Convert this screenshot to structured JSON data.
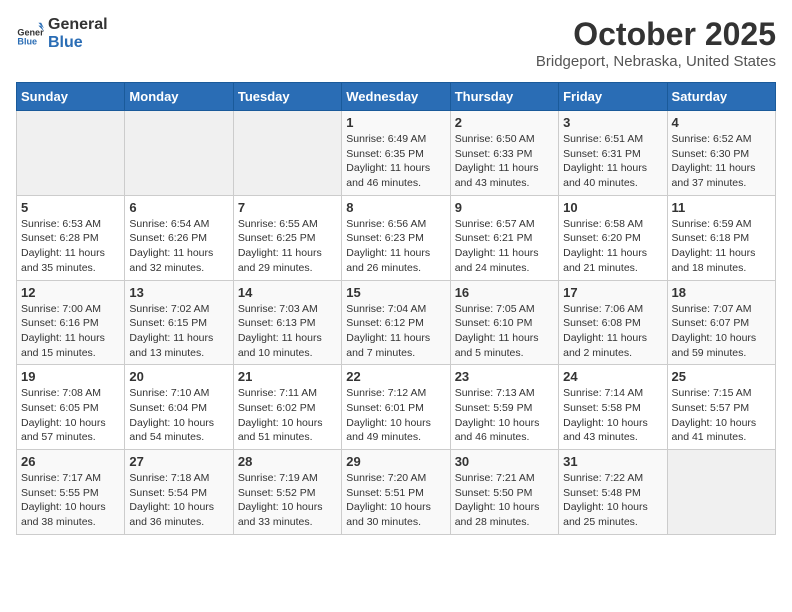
{
  "header": {
    "logo_general": "General",
    "logo_blue": "Blue",
    "month_title": "October 2025",
    "subtitle": "Bridgeport, Nebraska, United States"
  },
  "weekdays": [
    "Sunday",
    "Monday",
    "Tuesday",
    "Wednesday",
    "Thursday",
    "Friday",
    "Saturday"
  ],
  "weeks": [
    [
      {
        "day": "",
        "info": ""
      },
      {
        "day": "",
        "info": ""
      },
      {
        "day": "",
        "info": ""
      },
      {
        "day": "1",
        "info": "Sunrise: 6:49 AM\nSunset: 6:35 PM\nDaylight: 11 hours and 46 minutes."
      },
      {
        "day": "2",
        "info": "Sunrise: 6:50 AM\nSunset: 6:33 PM\nDaylight: 11 hours and 43 minutes."
      },
      {
        "day": "3",
        "info": "Sunrise: 6:51 AM\nSunset: 6:31 PM\nDaylight: 11 hours and 40 minutes."
      },
      {
        "day": "4",
        "info": "Sunrise: 6:52 AM\nSunset: 6:30 PM\nDaylight: 11 hours and 37 minutes."
      }
    ],
    [
      {
        "day": "5",
        "info": "Sunrise: 6:53 AM\nSunset: 6:28 PM\nDaylight: 11 hours and 35 minutes."
      },
      {
        "day": "6",
        "info": "Sunrise: 6:54 AM\nSunset: 6:26 PM\nDaylight: 11 hours and 32 minutes."
      },
      {
        "day": "7",
        "info": "Sunrise: 6:55 AM\nSunset: 6:25 PM\nDaylight: 11 hours and 29 minutes."
      },
      {
        "day": "8",
        "info": "Sunrise: 6:56 AM\nSunset: 6:23 PM\nDaylight: 11 hours and 26 minutes."
      },
      {
        "day": "9",
        "info": "Sunrise: 6:57 AM\nSunset: 6:21 PM\nDaylight: 11 hours and 24 minutes."
      },
      {
        "day": "10",
        "info": "Sunrise: 6:58 AM\nSunset: 6:20 PM\nDaylight: 11 hours and 21 minutes."
      },
      {
        "day": "11",
        "info": "Sunrise: 6:59 AM\nSunset: 6:18 PM\nDaylight: 11 hours and 18 minutes."
      }
    ],
    [
      {
        "day": "12",
        "info": "Sunrise: 7:00 AM\nSunset: 6:16 PM\nDaylight: 11 hours and 15 minutes."
      },
      {
        "day": "13",
        "info": "Sunrise: 7:02 AM\nSunset: 6:15 PM\nDaylight: 11 hours and 13 minutes."
      },
      {
        "day": "14",
        "info": "Sunrise: 7:03 AM\nSunset: 6:13 PM\nDaylight: 11 hours and 10 minutes."
      },
      {
        "day": "15",
        "info": "Sunrise: 7:04 AM\nSunset: 6:12 PM\nDaylight: 11 hours and 7 minutes."
      },
      {
        "day": "16",
        "info": "Sunrise: 7:05 AM\nSunset: 6:10 PM\nDaylight: 11 hours and 5 minutes."
      },
      {
        "day": "17",
        "info": "Sunrise: 7:06 AM\nSunset: 6:08 PM\nDaylight: 11 hours and 2 minutes."
      },
      {
        "day": "18",
        "info": "Sunrise: 7:07 AM\nSunset: 6:07 PM\nDaylight: 10 hours and 59 minutes."
      }
    ],
    [
      {
        "day": "19",
        "info": "Sunrise: 7:08 AM\nSunset: 6:05 PM\nDaylight: 10 hours and 57 minutes."
      },
      {
        "day": "20",
        "info": "Sunrise: 7:10 AM\nSunset: 6:04 PM\nDaylight: 10 hours and 54 minutes."
      },
      {
        "day": "21",
        "info": "Sunrise: 7:11 AM\nSunset: 6:02 PM\nDaylight: 10 hours and 51 minutes."
      },
      {
        "day": "22",
        "info": "Sunrise: 7:12 AM\nSunset: 6:01 PM\nDaylight: 10 hours and 49 minutes."
      },
      {
        "day": "23",
        "info": "Sunrise: 7:13 AM\nSunset: 5:59 PM\nDaylight: 10 hours and 46 minutes."
      },
      {
        "day": "24",
        "info": "Sunrise: 7:14 AM\nSunset: 5:58 PM\nDaylight: 10 hours and 43 minutes."
      },
      {
        "day": "25",
        "info": "Sunrise: 7:15 AM\nSunset: 5:57 PM\nDaylight: 10 hours and 41 minutes."
      }
    ],
    [
      {
        "day": "26",
        "info": "Sunrise: 7:17 AM\nSunset: 5:55 PM\nDaylight: 10 hours and 38 minutes."
      },
      {
        "day": "27",
        "info": "Sunrise: 7:18 AM\nSunset: 5:54 PM\nDaylight: 10 hours and 36 minutes."
      },
      {
        "day": "28",
        "info": "Sunrise: 7:19 AM\nSunset: 5:52 PM\nDaylight: 10 hours and 33 minutes."
      },
      {
        "day": "29",
        "info": "Sunrise: 7:20 AM\nSunset: 5:51 PM\nDaylight: 10 hours and 30 minutes."
      },
      {
        "day": "30",
        "info": "Sunrise: 7:21 AM\nSunset: 5:50 PM\nDaylight: 10 hours and 28 minutes."
      },
      {
        "day": "31",
        "info": "Sunrise: 7:22 AM\nSunset: 5:48 PM\nDaylight: 10 hours and 25 minutes."
      },
      {
        "day": "",
        "info": ""
      }
    ]
  ]
}
